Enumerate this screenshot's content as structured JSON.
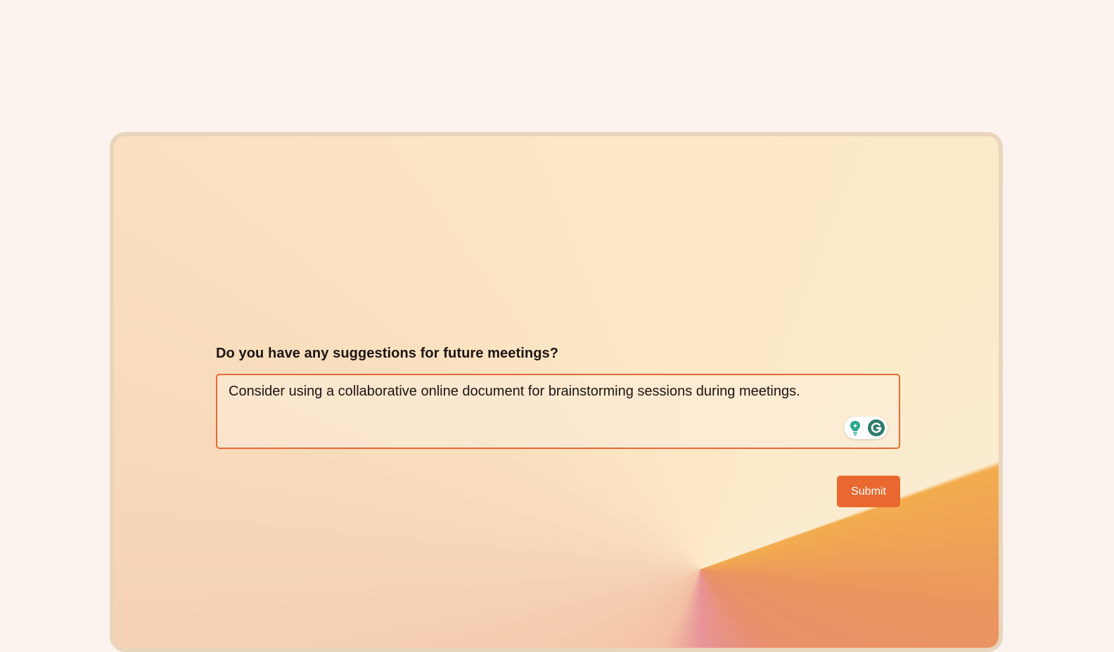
{
  "form": {
    "question": "Do you have any suggestions for future meetings?",
    "answer": "Consider using a collaborative online document for brainstorming sessions during meetings.",
    "submit_label": "Submit"
  },
  "colors": {
    "page_background": "#fdf3ee",
    "accent": "#e8682f",
    "input_border": "#e76a37",
    "frame_border": "#e9d5bd",
    "grammarly_green": "#2f7a6b",
    "assist_green": "#27a98f"
  },
  "icons": {
    "assistant": "lightbulb-sparkle-icon",
    "grammarly": "grammarly-g-icon"
  }
}
